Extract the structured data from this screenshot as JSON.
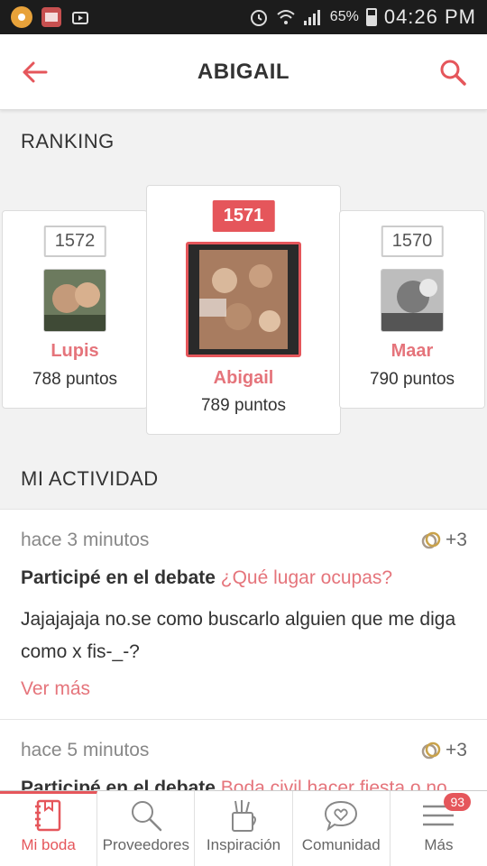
{
  "statusbar": {
    "battery": "65%",
    "time": "04:26 PM"
  },
  "header": {
    "title": "ABIGAIL"
  },
  "ranking": {
    "title": "RANKING",
    "left": {
      "points": "1572",
      "name": "Lupis",
      "score": "788 puntos"
    },
    "center": {
      "points": "1571",
      "name": "Abigail",
      "score": "789 puntos"
    },
    "right": {
      "points": "1570",
      "name": "Maar",
      "score": "790 puntos"
    }
  },
  "activity": {
    "title": "MI ACTIVIDAD",
    "items": [
      {
        "time": "hace 3 minutos",
        "points": "+3",
        "prefix": "Participé en el debate ",
        "link": "¿Qué lugar ocupas?",
        "body": "Jajajajaja no.se como buscarlo alguien que me diga como x fis-_-?",
        "more": "Ver más"
      },
      {
        "time": "hace 5 minutos",
        "points": "+3",
        "prefix": "Participé en el debate ",
        "link": "Boda civil hacer fiesta o no"
      }
    ]
  },
  "nav": {
    "items": [
      {
        "label": "Mi boda"
      },
      {
        "label": "Proveedores"
      },
      {
        "label": "Inspiración"
      },
      {
        "label": "Comunidad"
      },
      {
        "label": "Más",
        "badge": "93"
      }
    ]
  },
  "colors": {
    "accent": "#e5565b",
    "accent_light": "#e5747b"
  }
}
